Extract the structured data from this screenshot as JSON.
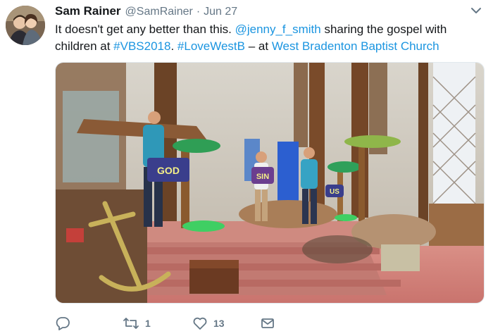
{
  "tweet": {
    "display_name": "Sam Rainer",
    "handle": "@SamRainer",
    "separator": "·",
    "time": "Jun 27",
    "text": {
      "part1": "It doesn't get any better than this. ",
      "mention": "@jenny_f_smith",
      "part2": " sharing the gospel with children at ",
      "hashtag1": "#VBS2018",
      "part3": ". ",
      "hashtag2": "#LoveWestB",
      "part4": " – at ",
      "location": "West Bradenton Baptist Church"
    },
    "media": {
      "scene_signs": [
        "GOD",
        "SIN",
        "US"
      ]
    },
    "actions": {
      "reply_count": "",
      "retweet_count": "1",
      "like_count": "13"
    }
  },
  "icons": [
    "avatar",
    "chevron-down-icon",
    "reply-icon",
    "retweet-icon",
    "like-icon",
    "message-icon"
  ],
  "colors": {
    "link": "#1b95e0",
    "text": "#14171a",
    "muted": "#657786"
  }
}
